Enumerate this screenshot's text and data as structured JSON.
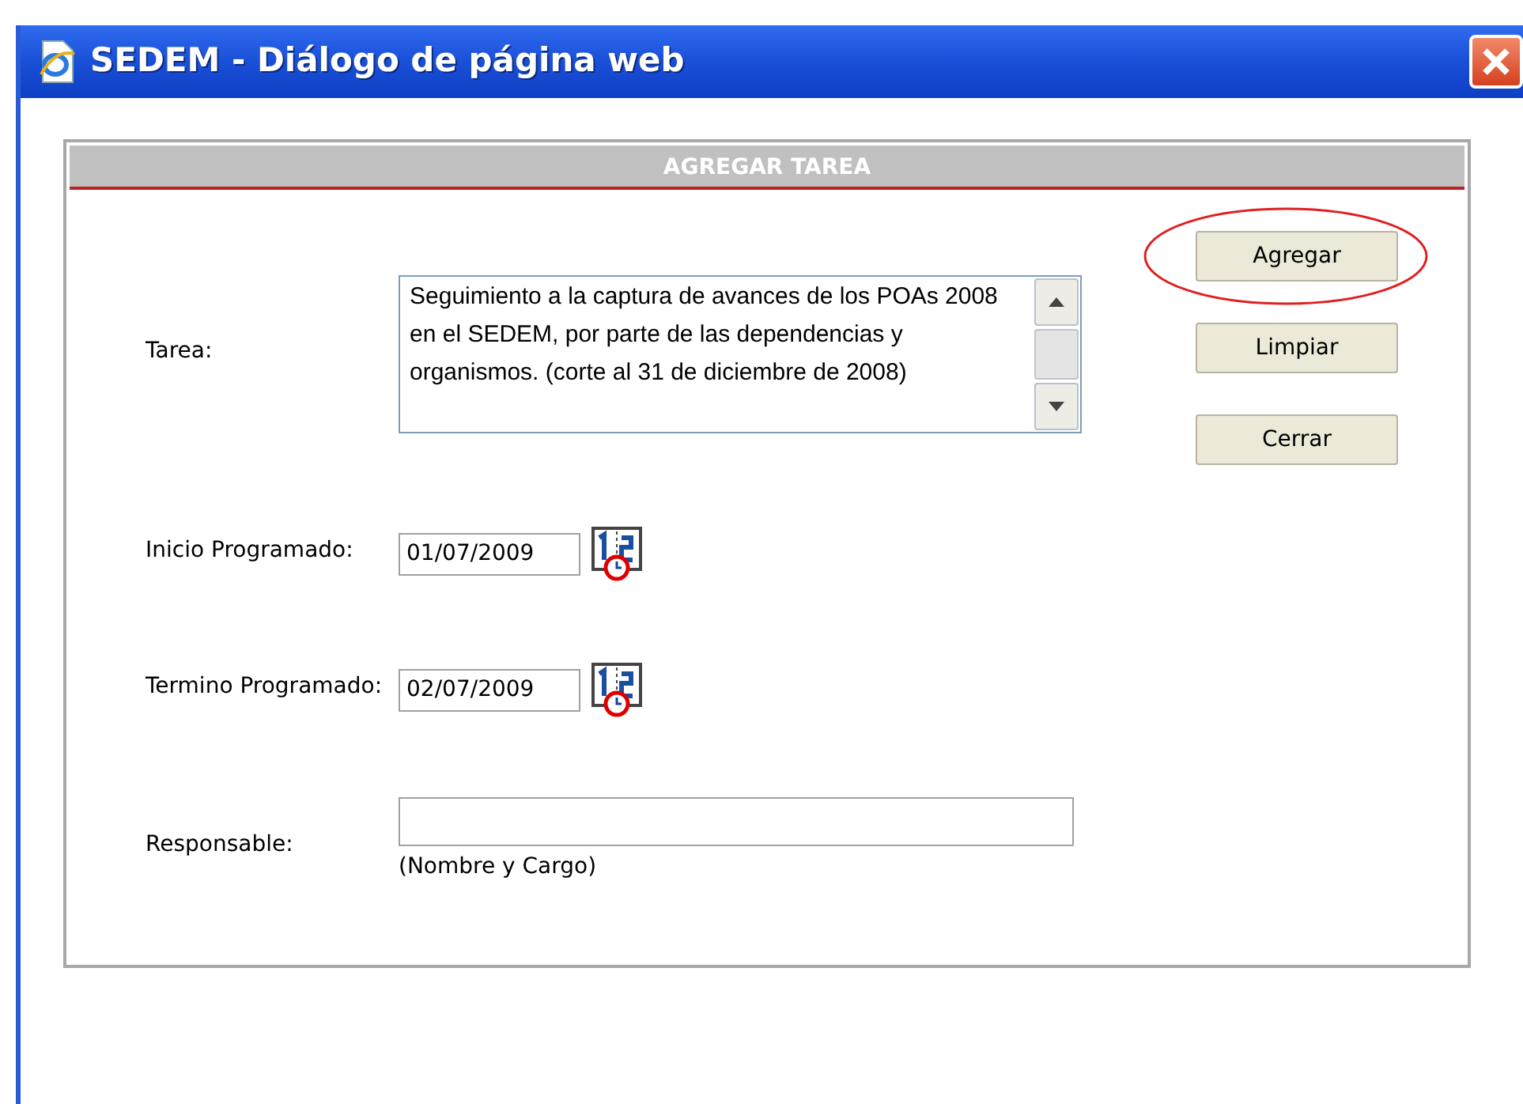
{
  "window": {
    "title": "SEDEM - Diálogo de página web"
  },
  "panel": {
    "title": "AGREGAR TAREA"
  },
  "fields": [
    {
      "kind": "textarea",
      "label": "Tarea:",
      "value": "Seguimiento a la captura de avances de los POAs 2008 en el SEDEM, por parte de las dependencias y organismos. (corte al 31 de diciembre de 2008)"
    },
    {
      "kind": "date",
      "label": "Inicio Programado:",
      "value": "01/07/2009"
    },
    {
      "kind": "date",
      "label": "Termino Programado:",
      "value": "02/07/2009"
    },
    {
      "kind": "text",
      "label": "Responsable:",
      "hint": "(Nombre y Cargo)"
    }
  ],
  "buttons": [
    {
      "label": "Agregar",
      "highlighted": true
    },
    {
      "label": "Limpiar",
      "highlighted": false
    },
    {
      "label": "Cerrar",
      "highlighted": false
    }
  ]
}
